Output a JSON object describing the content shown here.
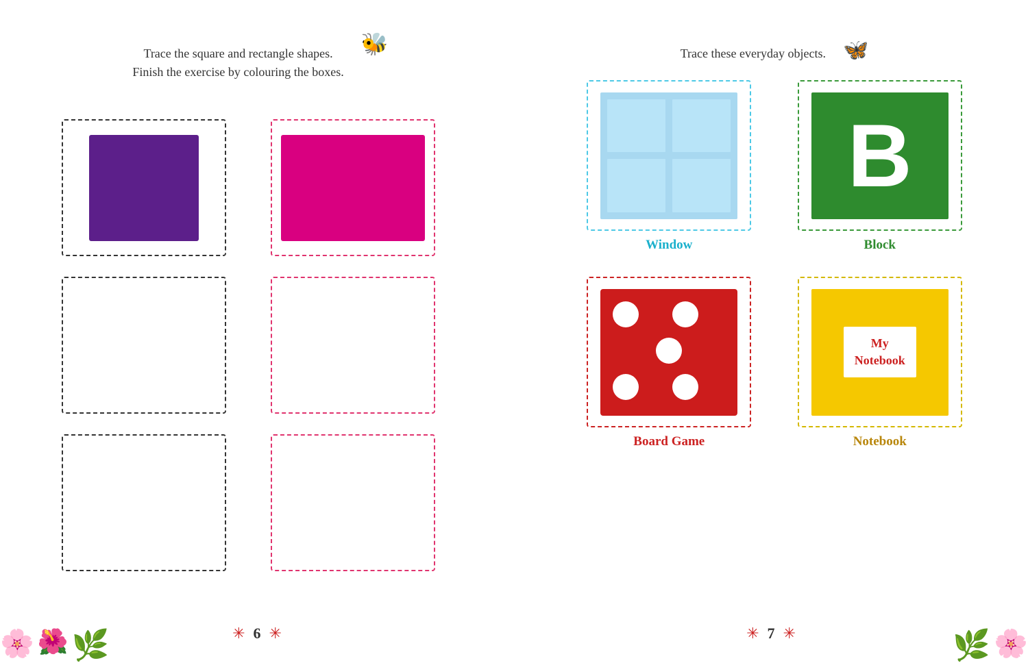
{
  "left_page": {
    "instruction_line1": "Trace the square and rectangle shapes.",
    "instruction_line2": "Finish the exercise by colouring the boxes.",
    "page_number": "6",
    "bee_icon": "🐝"
  },
  "right_page": {
    "instruction": "Trace these everyday objects.",
    "butterfly_icon": "🦋",
    "page_number": "7",
    "objects": [
      {
        "label": "Window",
        "color_class": "label-cyan"
      },
      {
        "label": "Block",
        "color_class": "label-green"
      },
      {
        "label": "Board Game",
        "color_class": "label-red"
      },
      {
        "label": "Notebook",
        "color_class": "label-yellow-dark"
      }
    ]
  }
}
